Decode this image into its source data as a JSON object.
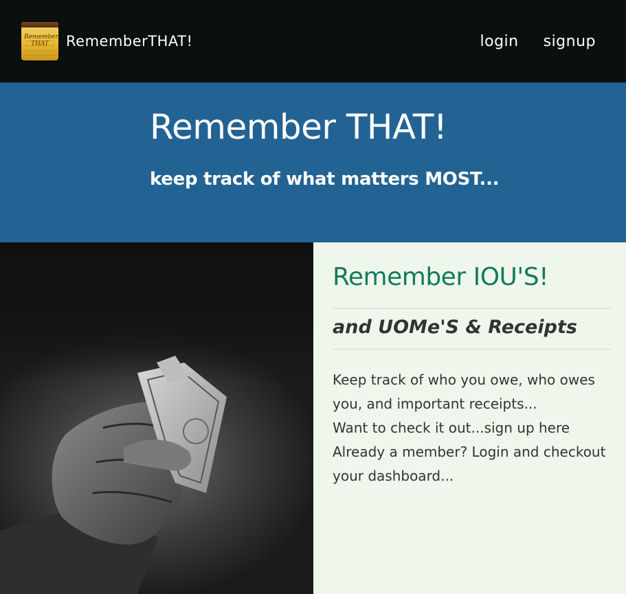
{
  "navbar": {
    "brand": "RememberTHAT!",
    "logo_text": "Remember!! THAT",
    "links": [
      {
        "label": "login"
      },
      {
        "label": "signup"
      }
    ]
  },
  "hero": {
    "title": "Remember THAT!",
    "subtitle": "keep track of what matters MOST..."
  },
  "section": {
    "title": "Remember IOU'S!",
    "subtitle": "and UOMe'S & Receipts",
    "body": [
      "Keep track of who you owe, who owes you, and important receipts...",
      "Want to check it out...sign up here",
      "Already a member? Login and checkout your dashboard..."
    ]
  },
  "colors": {
    "navbar_bg": "#0b0f0d",
    "hero_bg": "#236394",
    "section_bg": "#eff7ec",
    "section_title": "#137a5e",
    "body_text": "#333333"
  },
  "icons": {
    "logo": "notepad-logo-icon",
    "photo": "hand-holding-dollar-photo"
  }
}
